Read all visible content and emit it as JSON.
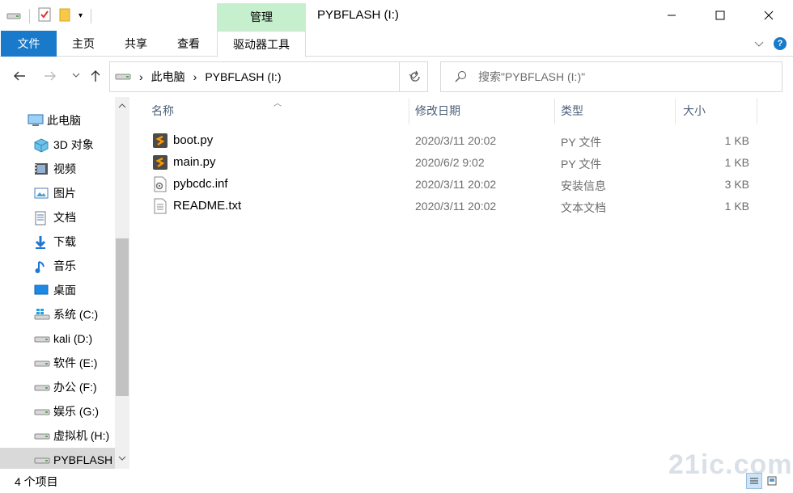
{
  "window": {
    "title": "PYBFLASH (I:)",
    "context_group": "管理",
    "controls": [
      "minimize-icon",
      "maximize-icon",
      "close-icon"
    ]
  },
  "ribbon": {
    "tabs": [
      {
        "label": "文件",
        "kind": "file"
      },
      {
        "label": "主页"
      },
      {
        "label": "共享"
      },
      {
        "label": "查看"
      },
      {
        "label": "驱动器工具",
        "active": true
      }
    ],
    "help_label": "?"
  },
  "address": {
    "crumbs": [
      "此电脑",
      "PYBFLASH (I:)"
    ],
    "separator": "›"
  },
  "search": {
    "placeholder": "搜索\"PYBFLASH (I:)\""
  },
  "nav_pane": {
    "items": [
      {
        "label": "此电脑",
        "icon": "computer-icon",
        "root": true
      },
      {
        "label": "3D 对象",
        "icon": "cube-3d-icon"
      },
      {
        "label": "视频",
        "icon": "video-icon"
      },
      {
        "label": "图片",
        "icon": "pictures-icon"
      },
      {
        "label": "文档",
        "icon": "documents-icon"
      },
      {
        "label": "下载",
        "icon": "download-icon"
      },
      {
        "label": "音乐",
        "icon": "music-icon"
      },
      {
        "label": "桌面",
        "icon": "desktop-icon"
      },
      {
        "label": "系统 (C:)",
        "icon": "windows-drive-icon"
      },
      {
        "label": "kali (D:)",
        "icon": "drive-icon"
      },
      {
        "label": "软件 (E:)",
        "icon": "drive-icon"
      },
      {
        "label": "办公 (F:)",
        "icon": "drive-icon"
      },
      {
        "label": "娱乐 (G:)",
        "icon": "drive-icon"
      },
      {
        "label": "虚拟机 (H:)",
        "icon": "drive-icon"
      },
      {
        "label": "PYBFLASH (I:)",
        "icon": "drive-icon",
        "selected": true
      }
    ]
  },
  "file_list": {
    "columns": [
      "名称",
      "修改日期",
      "类型",
      "大小"
    ],
    "rows": [
      {
        "name": "boot.py",
        "date": "2020/3/11 20:02",
        "type": "PY 文件",
        "size": "1 KB",
        "icon": "python-file-icon"
      },
      {
        "name": "main.py",
        "date": "2020/6/2 9:02",
        "type": "PY 文件",
        "size": "1 KB",
        "icon": "python-file-icon"
      },
      {
        "name": "pybcdc.inf",
        "date": "2020/3/11 20:02",
        "type": "安装信息",
        "size": "3 KB",
        "icon": "setup-info-icon"
      },
      {
        "name": "README.txt",
        "date": "2020/3/11 20:02",
        "type": "文本文档",
        "size": "1 KB",
        "icon": "text-file-icon"
      }
    ]
  },
  "status": {
    "item_count": "4 个项目"
  },
  "watermark": "21ic.com",
  "colors": {
    "file_tab": "#1979ca",
    "context_group": "#c6efce",
    "header_text": "#4c607a",
    "selected_nav": "#d9d9d9"
  }
}
